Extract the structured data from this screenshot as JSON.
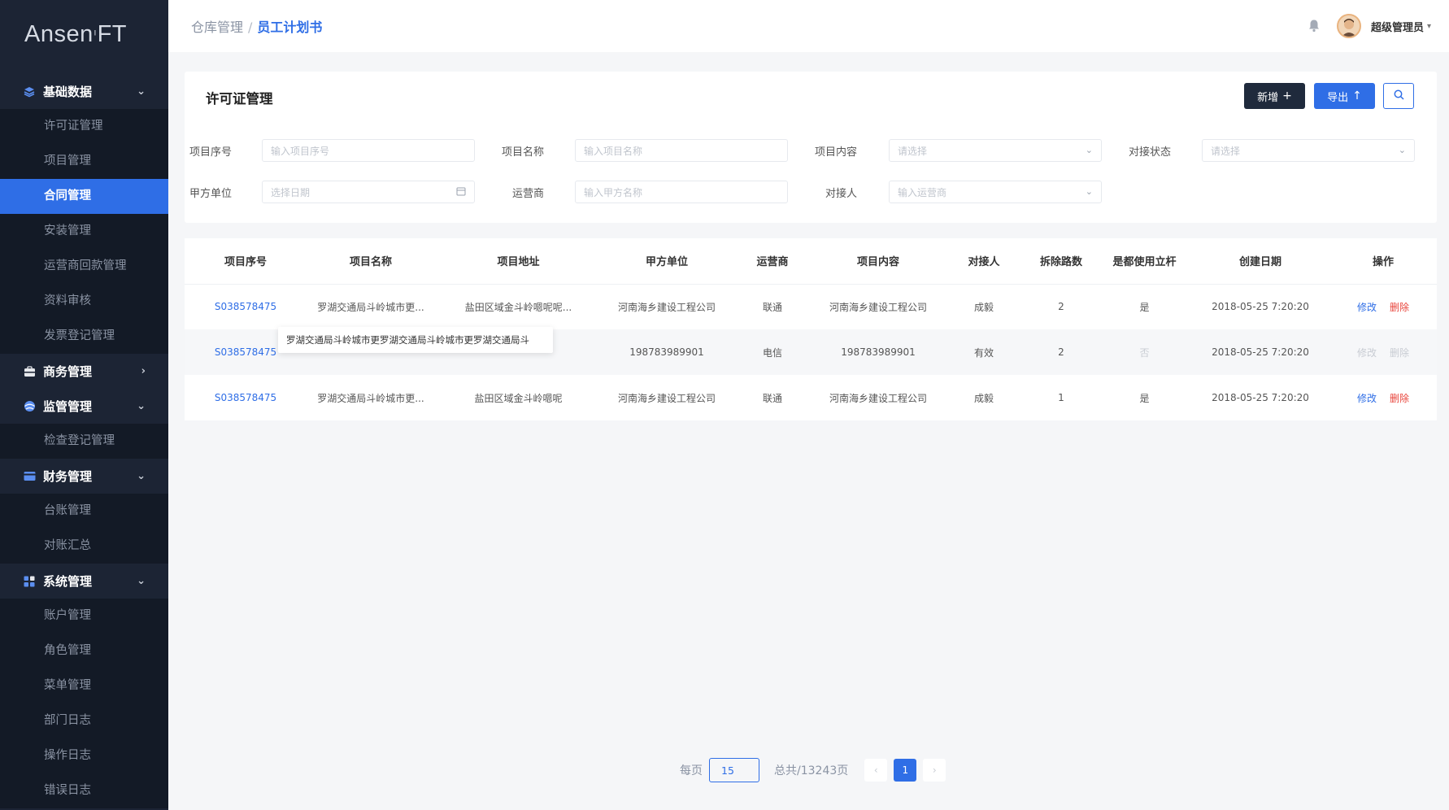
{
  "app": {
    "logo_text": "Ansen",
    "logo_mark": "ᴵ",
    "logo_suffix": "FT"
  },
  "sidebar": {
    "groups": [
      {
        "label": "基础数据",
        "icon": "layers-icon",
        "expanded": true,
        "items": [
          {
            "label": "许可证管理"
          },
          {
            "label": "项目管理"
          },
          {
            "label": "合同管理",
            "active": true
          },
          {
            "label": "安装管理"
          },
          {
            "label": "运营商回款管理"
          },
          {
            "label": "资料审核"
          },
          {
            "label": "发票登记管理"
          }
        ]
      },
      {
        "label": "商务管理",
        "icon": "briefcase-icon",
        "expanded": false,
        "items": []
      },
      {
        "label": "监管管理",
        "icon": "globe-icon",
        "expanded": true,
        "items": [
          {
            "label": "检查登记管理"
          }
        ]
      },
      {
        "label": "财务管理",
        "icon": "card-icon",
        "expanded": true,
        "items": [
          {
            "label": "台账管理"
          },
          {
            "label": "对账汇总"
          }
        ]
      },
      {
        "label": "系统管理",
        "icon": "grid-icon",
        "expanded": true,
        "items": [
          {
            "label": "账户管理"
          },
          {
            "label": "角色管理"
          },
          {
            "label": "菜单管理"
          },
          {
            "label": "部门日志"
          },
          {
            "label": "操作日志"
          },
          {
            "label": "错误日志"
          }
        ]
      }
    ]
  },
  "header": {
    "breadcrumb_parent": "仓库管理",
    "breadcrumb_sep": "/",
    "breadcrumb_current": "员工计划书",
    "user_name": "超级管理员"
  },
  "filters": {
    "title": "许可证管理",
    "add_label": "新增",
    "export_label": "导出",
    "fields": {
      "project_no": {
        "label": "项目序号",
        "placeholder": "输入项目序号"
      },
      "project_name": {
        "label": "项目名称",
        "placeholder": "输入项目名称"
      },
      "project_content": {
        "label": "项目内容",
        "placeholder": "请选择"
      },
      "connect_status": {
        "label": "对接状态",
        "placeholder": "请选择"
      },
      "party_a": {
        "label": "甲方单位",
        "placeholder": "选择日期"
      },
      "operator": {
        "label": "运营商",
        "placeholder": "输入甲方名称"
      },
      "contact": {
        "label": "对接人",
        "placeholder": "输入运营商"
      }
    }
  },
  "table": {
    "columns": [
      "项目序号",
      "项目名称",
      "项目地址",
      "甲方单位",
      "运营商",
      "项目内容",
      "对接人",
      "拆除路数",
      "是都使用立杆",
      "创建日期",
      "操作"
    ],
    "rows": [
      {
        "no": "S038578475",
        "name": "罗湖交通局斗岭城市更...",
        "addr": "盐田区域金斗岭嗯呢呢...",
        "party": "河南海乡建设工程公司",
        "op": "联通",
        "content": "河南海乡建设工程公司",
        "contact": "成毅",
        "count": "2",
        "pole": "是",
        "date": "2018-05-25 7:20:20",
        "edit": "修改",
        "del": "删除"
      },
      {
        "no": "S038578475",
        "name": "",
        "addr": "",
        "party": "198783989901",
        "op": "电信",
        "content": "198783989901",
        "contact": "有效",
        "count": "2",
        "pole": "否",
        "date": "2018-05-25 7:20:20",
        "edit": "修改",
        "del": "删除"
      },
      {
        "no": "S038578475",
        "name": "罗湖交通局斗岭城市更...",
        "addr": "盐田区域金斗岭嗯呢",
        "party": "河南海乡建设工程公司",
        "op": "联通",
        "content": "河南海乡建设工程公司",
        "contact": "成毅",
        "count": "1",
        "pole": "是",
        "date": "2018-05-25 7:20:20",
        "edit": "修改",
        "del": "删除"
      }
    ],
    "tooltip": "罗湖交通局斗岭城市更罗湖交通局斗岭城市更罗湖交通局斗"
  },
  "pagination": {
    "per_page_label": "每页",
    "per_page_value": "15",
    "total_label": "总共/13243页",
    "current_page": "1"
  }
}
